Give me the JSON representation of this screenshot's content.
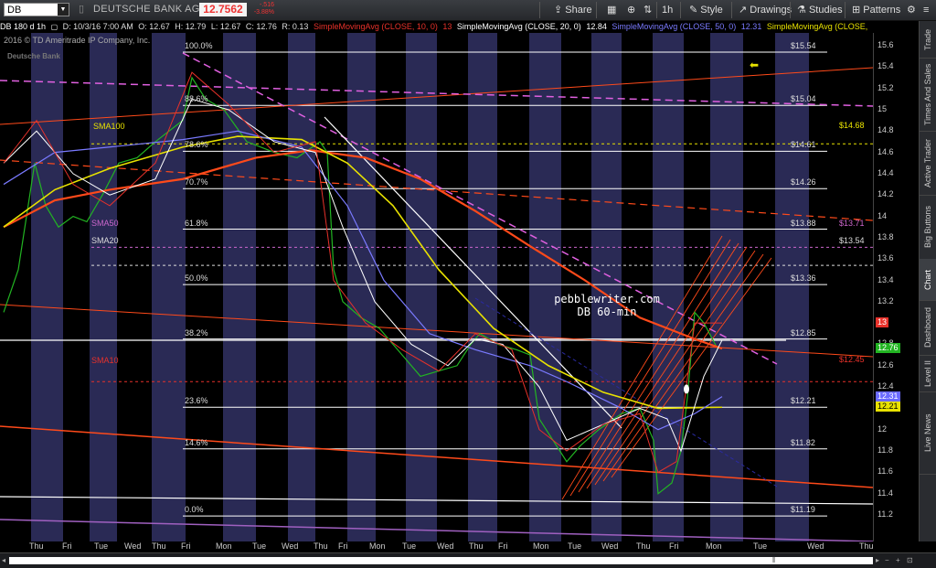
{
  "toolbar": {
    "symbol": "DB",
    "company": "DEUTSCHE BANK AG ORD",
    "last_price": "12.7562",
    "change": "-.516",
    "change_pct": "-3.88%",
    "share": "Share",
    "interval": "1h",
    "style": "Style",
    "drawings": "Drawings",
    "studies": "Studies",
    "patterns": "Patterns"
  },
  "status": {
    "sym": "DB 180 d 1h",
    "date": "D: 10/3/16 7:00 AM",
    "open": "O: 12.67",
    "high": "H: 12.79",
    "low": "L: 12.67",
    "close": "C: 12.76",
    "range": "R: 0.13",
    "sma10": "SimpleMovingAvg (CLOSE, 10, 0)",
    "sma10_val": "13",
    "sma20": "SimpleMovingAvg (CLOSE, 20, 0)",
    "sma20_val": "12.84",
    "sma50": "SimpleMovingAvg (CLOSE, 50, 0)",
    "sma50_val": "12.31",
    "sma100": "SimpleMovingAvg (CLOSE,"
  },
  "chart": {
    "copyright": "2016 © TD Ameritrade IP Company, Inc.",
    "mini_logo": "Deutsche Bank",
    "watermark_line1": "pebblewriter.com",
    "watermark_line2": "DB 60-min",
    "fib_levels": [
      {
        "pct": "100.0%",
        "price": "$15.54"
      },
      {
        "pct": "88.6%",
        "price": "$15.04"
      },
      {
        "pct": "78.6%",
        "price": "$14.61"
      },
      {
        "pct": "70.7%",
        "price": "$14.26"
      },
      {
        "pct": "61.8%",
        "price": "$13.88"
      },
      {
        "pct": "50.0%",
        "price": "$13.36"
      },
      {
        "pct": "38.2%",
        "price": "$12.85"
      },
      {
        "pct": "23.6%",
        "price": "$12.21"
      },
      {
        "pct": "14.6%",
        "price": "$11.82"
      },
      {
        "pct": "0.0%",
        "price": "$11.19"
      }
    ],
    "sma_labels": {
      "sma100": "SMA100",
      "sma100_val": "$14.68",
      "sma50": "SMA50",
      "sma50_val": "$13.71",
      "sma20": "SMA20",
      "sma20_val": "$13.54",
      "sma10": "SMA10",
      "sma10_val": "$12.45"
    },
    "colors": {
      "sma10": "#e8312a",
      "sma20": "#ffffff",
      "sma50": "#7a7aff",
      "sma100": "#e8e200",
      "sma200": "#ff4a1a",
      "fib": "#ffffff",
      "trend": "#ff4a1a",
      "dashed": "#e060e0",
      "background_stripe": "#2a2a55"
    }
  },
  "yaxis": {
    "labels": [
      "15.6",
      "15.4",
      "15.2",
      "15",
      "14.8",
      "14.6",
      "14.4",
      "14.2",
      "14",
      "13.8",
      "13.6",
      "13.4",
      "13.2",
      "13",
      "12.8",
      "12.6",
      "12.4",
      "12.2",
      "12",
      "11.8",
      "11.6",
      "11.4",
      "11.2"
    ],
    "tags": [
      {
        "text": "13",
        "color": "#e8312a",
        "fg": "#fff"
      },
      {
        "text": "12.76",
        "color": "#22b422",
        "fg": "#fff"
      },
      {
        "text": "12.31",
        "color": "#6a6aff",
        "fg": "#fff"
      },
      {
        "text": "12.21",
        "color": "#e8e200",
        "fg": "#000"
      }
    ]
  },
  "xaxis": {
    "labels": [
      "Thu",
      "Fri",
      "Tue",
      "Wed",
      "Thu",
      "Fri",
      "Mon",
      "Tue",
      "Wed",
      "Thu",
      "Fri",
      "Mon",
      "Tue",
      "Wed",
      "Thu",
      "Fri",
      "Mon",
      "Tue",
      "Wed",
      "Thu",
      "Fri",
      "Mon",
      "Tue",
      "Wed",
      "Thu"
    ]
  },
  "sidebar": {
    "items": [
      "Trade",
      "Times And Sales",
      "Active Trader",
      "Big Buttons",
      "Chart",
      "Dashboard",
      "Level II",
      "Live News"
    ]
  }
}
